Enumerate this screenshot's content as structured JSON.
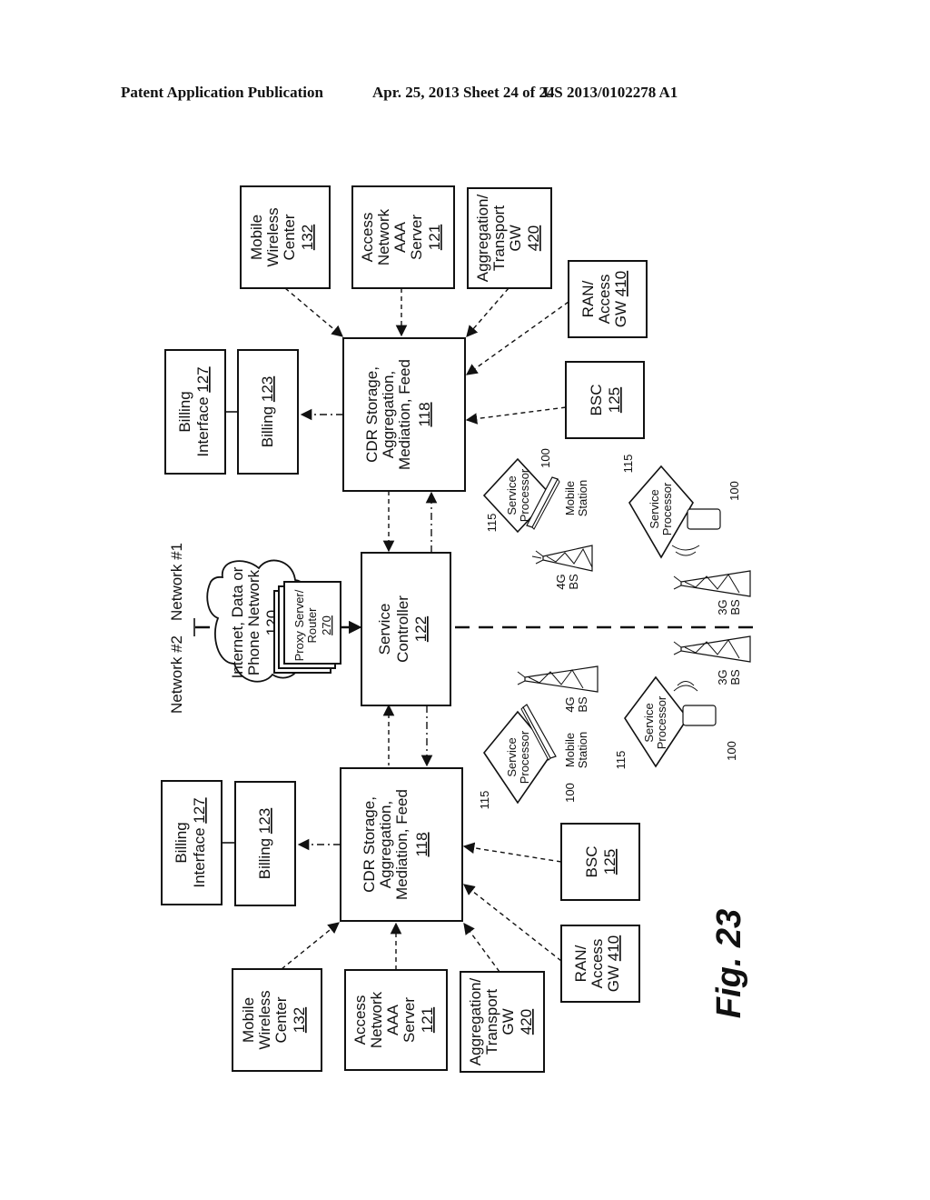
{
  "header": {
    "publication": "Patent Application Publication",
    "date_sheet": "Apr. 25, 2013  Sheet 24 of 24",
    "number": "US 2013/0102278 A1"
  },
  "figure": {
    "label": "Fig. 23",
    "network_labels": {
      "left": "Network #1",
      "right": "Network #2"
    },
    "cloud": {
      "lines": [
        "Internet, Data or",
        "Phone Network"
      ],
      "ref": "120"
    },
    "proxy": {
      "lines": [
        "Proxy Server/",
        "Router"
      ],
      "ref": "270"
    },
    "service_controller": {
      "lines": [
        "Service",
        "Controller"
      ],
      "ref": "122"
    },
    "network2": {
      "cdr": {
        "lines": [
          "CDR Storage,",
          "Aggregation,",
          "Mediation, Feed"
        ],
        "ref": "118"
      },
      "billing": {
        "text": "Billing",
        "ref": "123"
      },
      "billing_interface": {
        "line1": "Billing",
        "line2": "Interface",
        "ref": "127"
      },
      "mwc": {
        "lines": [
          "Mobile",
          "Wireless",
          "Center"
        ],
        "ref": "132"
      },
      "aaa": {
        "lines": [
          "Access",
          "Network",
          "AAA",
          "Server"
        ],
        "ref": "121"
      },
      "agg_gw": {
        "lines": [
          "Aggregation/",
          "Transport",
          "GW"
        ],
        "ref": "420"
      },
      "ran_gw": {
        "line1": "RAN/",
        "line2": "Access",
        "line3": "GW",
        "ref": "410"
      },
      "bsc": {
        "text": "BSC",
        "ref": "125"
      }
    },
    "network1": {
      "cdr": {
        "lines": [
          "CDR Storage,",
          "Aggregation,",
          "Mediation, Feed"
        ],
        "ref": "118"
      },
      "billing": {
        "text": "Billing",
        "ref": "123"
      },
      "billing_interface": {
        "line1": "Billing",
        "line2": "Interface",
        "ref": "127"
      },
      "mwc": {
        "lines": [
          "Mobile",
          "Wireless",
          "Center"
        ],
        "ref": "132"
      },
      "aaa": {
        "lines": [
          "Access",
          "Network",
          "AAA",
          "Server"
        ],
        "ref": "121"
      },
      "agg_gw": {
        "lines": [
          "Aggregation/",
          "Transport",
          "GW"
        ],
        "ref": "420"
      },
      "ran_gw": {
        "line1": "RAN/",
        "line2": "Access",
        "line3": "GW",
        "ref": "410"
      },
      "bsc": {
        "text": "BSC",
        "ref": "125"
      }
    },
    "devices": {
      "service_processor": [
        "Service",
        "Processor"
      ],
      "sp_ref": "115",
      "device_ref": "100",
      "mobile_station": [
        "Mobile",
        "Station"
      ],
      "bs_4g": [
        "4G",
        "BS"
      ],
      "bs_3g": [
        "3G",
        "BS"
      ]
    }
  }
}
